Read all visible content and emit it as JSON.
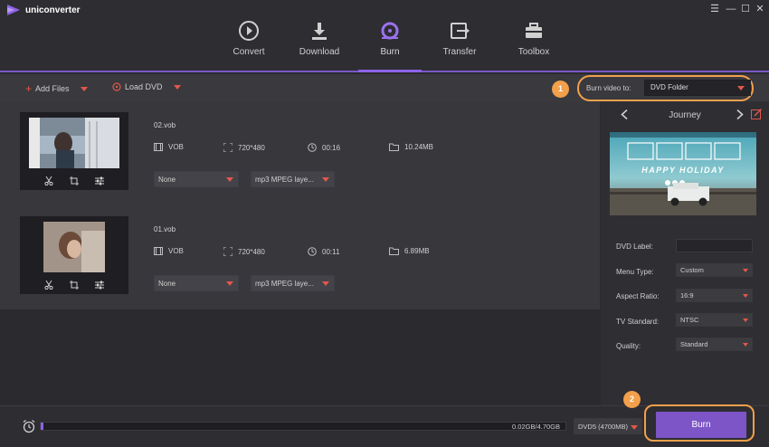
{
  "app": {
    "title": "uniconverter"
  },
  "nav": [
    {
      "label": "Convert",
      "icon": "convert-icon"
    },
    {
      "label": "Download",
      "icon": "download-icon"
    },
    {
      "label": "Burn",
      "icon": "burn-icon",
      "active": true
    },
    {
      "label": "Transfer",
      "icon": "transfer-icon"
    },
    {
      "label": "Toolbox",
      "icon": "toolbox-icon"
    }
  ],
  "toolbar": {
    "add_files": "Add Files",
    "load_dvd": "Load DVD",
    "burn_to_label": "Burn video to:",
    "burn_to_value": "DVD Folder",
    "badge1": "1"
  },
  "files": [
    {
      "name": "02.vob",
      "format": "VOB",
      "resolution": "720*480",
      "duration": "00:16",
      "size": "10.24MB",
      "subtitle": "None",
      "audio": "mp3 MPEG laye..."
    },
    {
      "name": "01.vob",
      "format": "VOB",
      "resolution": "720*480",
      "duration": "00:11",
      "size": "6.89MB",
      "subtitle": "None",
      "audio": "mp3 MPEG laye..."
    }
  ],
  "template": {
    "name": "Journey",
    "preview_title": "HAPPY HOLIDAY"
  },
  "settings": {
    "dvd_label": {
      "label": "DVD Label:",
      "value": ""
    },
    "menu_type": {
      "label": "Menu Type:",
      "value": "Custom"
    },
    "aspect_ratio": {
      "label": "Aspect Ratio:",
      "value": "16:9"
    },
    "tv_standard": {
      "label": "TV Standard:",
      "value": "NTSC"
    },
    "quality": {
      "label": "Quality:",
      "value": "Standard"
    }
  },
  "bottom": {
    "capacity_text": "0.02GB/4.70GB",
    "capacity_fraction": 0.004,
    "disc_type": "DVD5 (4700MB)",
    "badge2": "2",
    "burn_label": "Burn"
  },
  "colors": {
    "accent_purple": "#8c63e6",
    "highlight_orange": "#f2a04b",
    "accent_red": "#e2574a"
  }
}
